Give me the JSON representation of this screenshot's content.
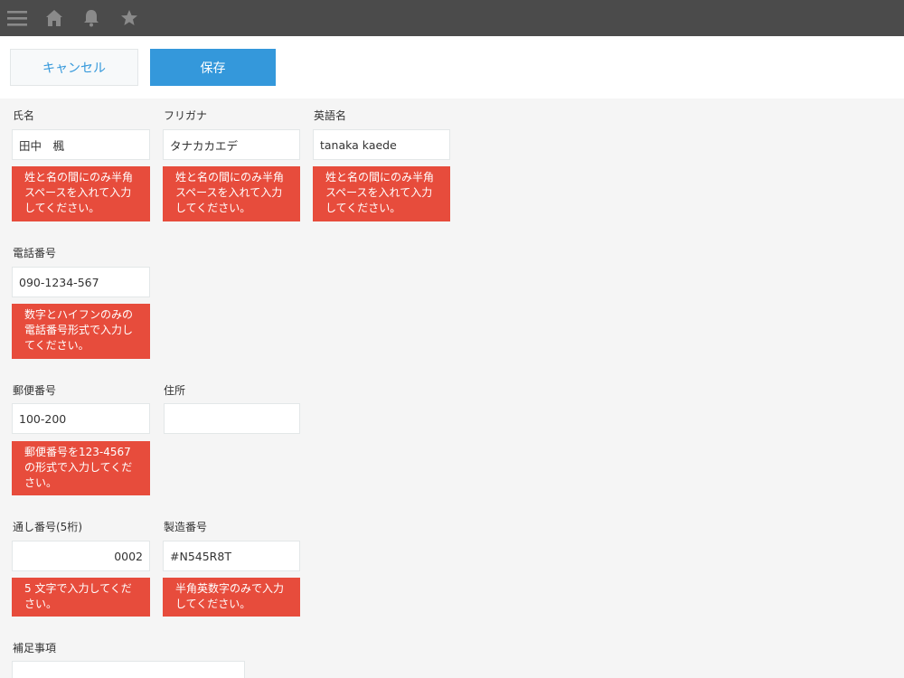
{
  "toolbar": {
    "menu_icon": "hamburger-menu-icon",
    "home_icon": "home-icon",
    "bell_icon": "bell-icon",
    "star_icon": "star-icon"
  },
  "actions": {
    "cancel_label": "キャンセル",
    "save_label": "保存"
  },
  "fields": {
    "name": {
      "label": "氏名",
      "value": "田中　楓",
      "error": "姓と名の間にのみ半角スペースを入れて入力してください。"
    },
    "furigana": {
      "label": "フリガナ",
      "value": "タナカカエデ",
      "error": "姓と名の間にのみ半角スペースを入れて入力してください。"
    },
    "english_name": {
      "label": "英語名",
      "value": "tanaka  kaede",
      "error": "姓と名の間にのみ半角スペースを入れて入力してください。"
    },
    "phone": {
      "label": "電話番号",
      "value": "090-1234-567",
      "error": "数字とハイフンのみの電話番号形式で入力してください。"
    },
    "postal": {
      "label": "郵便番号",
      "value": "100-200",
      "error": "郵便番号を123-4567の形式で入力してください。"
    },
    "address": {
      "label": "住所",
      "value": ""
    },
    "serial": {
      "label": "通し番号(5桁)",
      "value": "0002",
      "error": "5 文字で入力してください。"
    },
    "manufacture_no": {
      "label": "製造番号",
      "value": "#N545R8T",
      "error": "半角英数字のみで入力してください。"
    },
    "notes": {
      "label": "補足事項",
      "value": ""
    }
  },
  "colors": {
    "topbar": "#4b4b4b",
    "accent": "#3498db",
    "error": "#e74c3c",
    "background": "#f5f5f5"
  }
}
